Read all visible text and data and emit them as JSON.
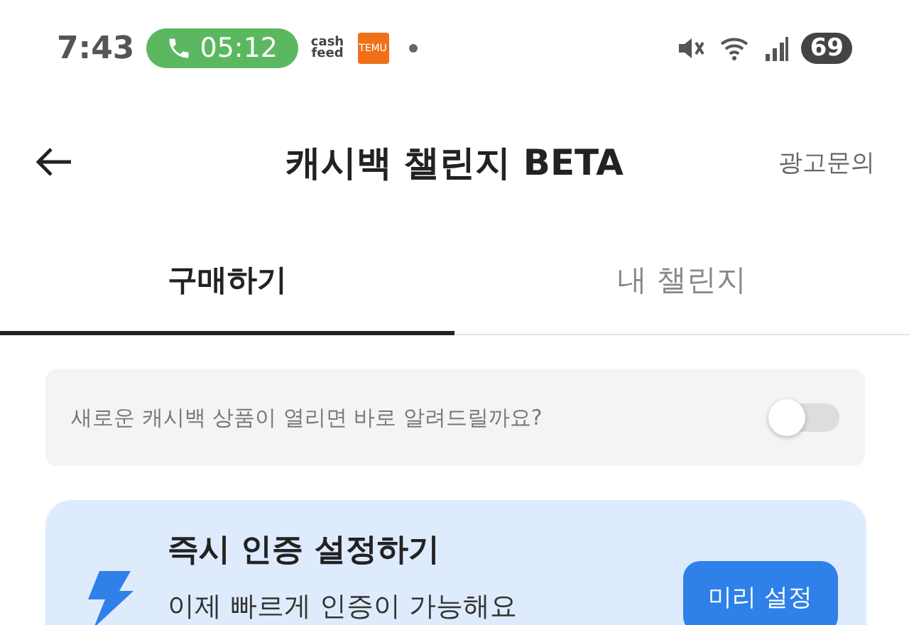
{
  "status_bar": {
    "time": "7:43",
    "call_timer": "05:12",
    "app_badges": [
      "cash feed",
      "TEMU"
    ],
    "battery": "69"
  },
  "header": {
    "title": "캐시백 챌린지 BETA",
    "action": "광고문의"
  },
  "tabs": [
    {
      "label": "구매하기",
      "selected": true
    },
    {
      "label": "내 챌린지",
      "selected": false
    }
  ],
  "notify": {
    "label": "새로운 캐시백 상품이 열리면 바로 알려드릴까요?",
    "on": false
  },
  "promo": {
    "title": "즉시 인증 설정하기",
    "subtitle": "이제 빠르게 인증이 가능해요",
    "button": "미리 설정"
  }
}
